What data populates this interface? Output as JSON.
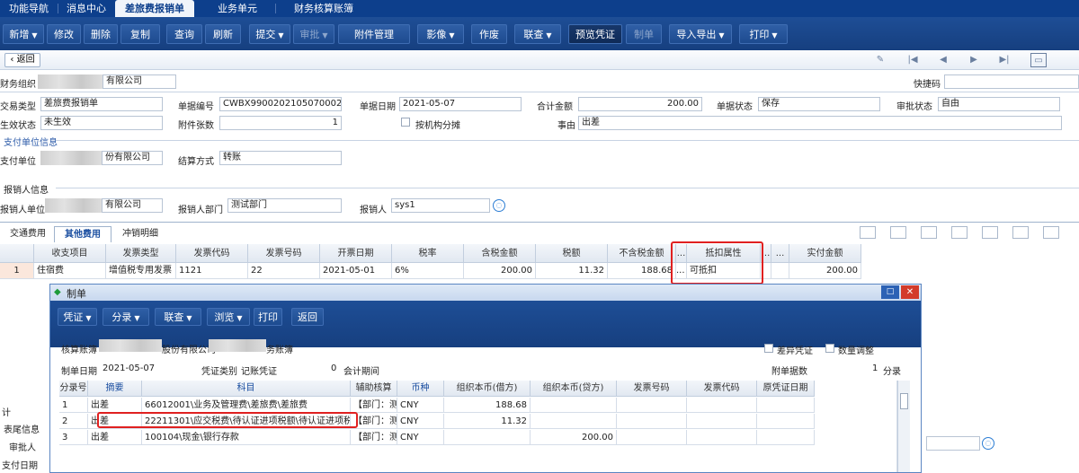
{
  "top_tabs": [
    "功能导航",
    "消息中心",
    "差旅费报销单",
    "业务单元",
    "财务核算账簿"
  ],
  "toolbar": {
    "new": "新增",
    "edit": "修改",
    "delete": "删除",
    "copy": "复制",
    "query": "查询",
    "refresh": "刷新",
    "submit": "提交",
    "approve": "审批",
    "attachment": "附件管理",
    "image": "影像",
    "void": "作废",
    "link_query": "联查",
    "preview_voucher": "预览凭证",
    "make_voucher": "制单",
    "import_export": "导入导出",
    "print": "打印"
  },
  "nav": {
    "back": "返回",
    "quick_code_label": "快捷码"
  },
  "form": {
    "finance_org_label": "财务组织",
    "finance_org_value": "有限公司",
    "trade_type_label": "交易类型",
    "trade_type_value": "差旅费报销单",
    "doc_no_label": "单据编号",
    "doc_no_value": "CWBX9900202105070002",
    "doc_date_label": "单据日期",
    "doc_date_value": "2021-05-07",
    "total_label": "合计金额",
    "total_value": "200.00",
    "doc_status_label": "单据状态",
    "doc_status_value": "保存",
    "approval_status_label": "审批状态",
    "approval_status_value": "自由",
    "effect_status_label": "生效状态",
    "effect_status_value": "未生效",
    "attach_count_label": "附件张数",
    "attach_count_value": "1",
    "share_label": "按机构分摊",
    "reason_label": "事由",
    "reason_value": "出差",
    "pay_section": "支付单位信息",
    "pay_unit_label": "支付单位",
    "pay_unit_value": "份有限公司",
    "settle_label": "结算方式",
    "settle_value": "转账",
    "claimant_section": "报销人信息",
    "claimant_unit_label": "报销人单位",
    "claimant_unit_value": "有限公司",
    "claimant_dept_label": "报销人部门",
    "claimant_dept_value": "测试部门",
    "claimant_label": "报销人",
    "claimant_value": "sys1"
  },
  "sub_tabs": [
    "交通费用",
    "其他费用",
    "冲销明细"
  ],
  "grid": {
    "headers": [
      "收支项目",
      "发票类型",
      "发票代码",
      "发票号码",
      "开票日期",
      "税率",
      "含税金额",
      "税额",
      "不含税金额",
      "...",
      "抵扣属性",
      "...",
      "...",
      "实付金额"
    ],
    "row": [
      "1",
      "住宿费",
      "增值税专用发票",
      "1121",
      "22",
      "2021-05-01",
      "6%",
      "200.00",
      "11.32",
      "188.68",
      "...",
      "可抵扣",
      "",
      "",
      "200.00"
    ]
  },
  "left_labels": [
    "计",
    "表尾信息",
    "审批人",
    "支付日期"
  ],
  "dialog": {
    "title": "制单",
    "buttons": [
      "凭证",
      "分录",
      "联查",
      "浏览",
      "打印",
      "返回"
    ],
    "book_label": "核算账簿",
    "book_value": "股份有限公司",
    "book_suffix": "务账簿",
    "diff_voucher": "差异凭证",
    "qty_adjust": "数量调整",
    "make_date_label": "制单日期",
    "make_date_value": "2021-05-07",
    "voucher_type_label": "凭证类别",
    "voucher_type_value": "记账凭证",
    "period_value": "0",
    "period_label": "会计期间",
    "attach_label": "附单据数",
    "attach_value": "1",
    "entry_label": "分录",
    "headers": [
      "分录号",
      "摘要",
      "科目",
      "辅助核算",
      "币种",
      "组织本币(借方)",
      "组织本币(贷方)",
      "发票号码",
      "发票代码",
      "原凭证日期"
    ],
    "rows": [
      [
        "1",
        "出差",
        "66012001\\业务及管理费\\差旅费\\差旅费",
        "【部门：测",
        "CNY",
        "188.68",
        ""
      ],
      [
        "2",
        "出差",
        "22211301\\应交税费\\待认证进项税额\\待认证进项税额",
        "【部门：测",
        "CNY",
        "11.32",
        ""
      ],
      [
        "3",
        "出差",
        "100104\\现金\\银行存款",
        "【部门：测",
        "CNY",
        "",
        "200.00"
      ]
    ]
  },
  "colors": {
    "header_blue": "#0d3f8c",
    "highlight_red": "#e02020",
    "link_blue": "#2b5aa8"
  }
}
